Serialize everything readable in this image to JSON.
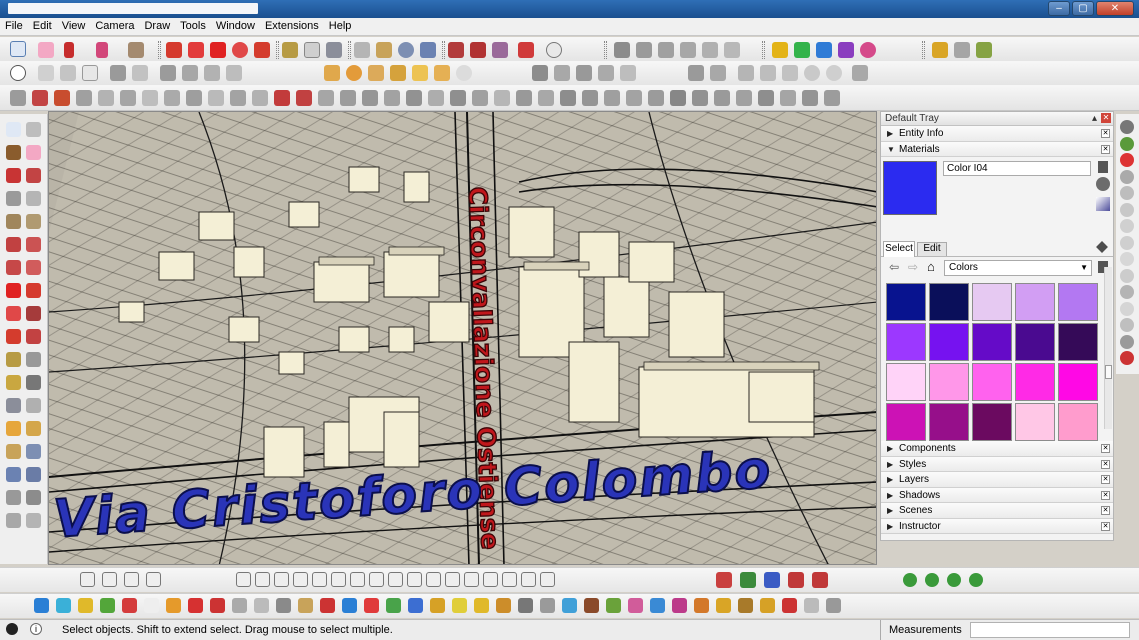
{
  "menu": [
    "File",
    "Edit",
    "View",
    "Camera",
    "Draw",
    "Tools",
    "Window",
    "Extensions",
    "Help"
  ],
  "viewport": {
    "label_red": "Circonvallazione Ostiense",
    "label_blue": "Via Cristoforo Colombo"
  },
  "tray": {
    "title": "Default Tray",
    "entity_info": "Entity Info",
    "materials": "Materials",
    "color_name": "Color I04",
    "tab_select": "Select",
    "tab_edit": "Edit",
    "library": "Colors",
    "swatch_colors": [
      "#08138f",
      "#0a0f5a",
      "#e6c9f2",
      "#d29ef3",
      "#b378f2",
      "#9c38ff",
      "#7612f0",
      "#650bc8",
      "#4a0a90",
      "#350a58",
      "#ffd3f8",
      "#ff97e9",
      "#ff62ee",
      "#ff2ae6",
      "#ff08e5",
      "#cc12b5",
      "#960f8a",
      "#6b0a60",
      "#ffc7e6",
      "#ff9ccd"
    ],
    "current_color": "#2b2bf0",
    "sections": [
      "Components",
      "Styles",
      "Layers",
      "Shadows",
      "Scenes",
      "Instructor"
    ]
  },
  "status": {
    "message": "Select objects. Shift to extend select. Drag mouse to select multiple.",
    "measurements_label": "Measurements"
  }
}
